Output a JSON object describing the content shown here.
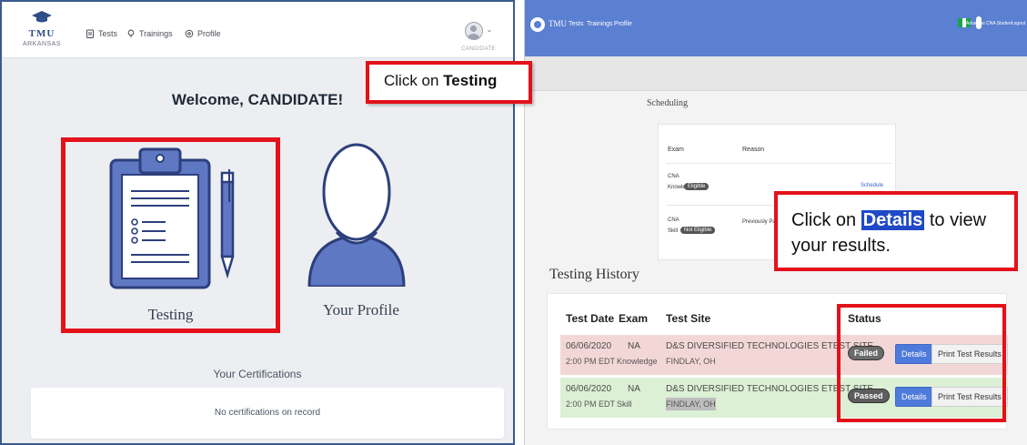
{
  "left_app": {
    "logo": {
      "name": "TMU",
      "subtitle": "ARKANSAS"
    },
    "nav": {
      "tests": "Tests",
      "trainings": "Trainings",
      "profile": "Profile"
    },
    "user_label": "CANDIDATE",
    "welcome": "Welcome, CANDIDATE!",
    "tiles": {
      "testing": "Testing",
      "profile": "Your Profile"
    },
    "certifications": {
      "title": "Your Certifications",
      "empty": "No certifications on record"
    }
  },
  "right_app": {
    "brand": "TMU",
    "nav": {
      "tests": "Tests",
      "trainings": "Trainings",
      "profile": "Profile"
    },
    "user_label": "Arkansas CNA Student",
    "logout": "Logout",
    "scheduling": {
      "title": "Scheduling",
      "headers": {
        "exam": "Exam",
        "reason": "Reason"
      },
      "rows": [
        {
          "exam": "CNA",
          "sub": "Knowledge",
          "chip": "Eligible",
          "reason": "",
          "action": "Schedule"
        },
        {
          "exam": "CNA",
          "sub": "Skill",
          "chip": "Not Eligible",
          "reason": "Previously Passed",
          "action": ""
        }
      ]
    },
    "history": {
      "title": "Testing History",
      "headers": {
        "date": "Test Date",
        "exam": "Exam",
        "site": "Test Site",
        "status": "Status"
      },
      "rows": [
        {
          "date": "06/06/2020",
          "time": "2:00 PM EDT",
          "exam": "NA",
          "exam_type": "Knowledge",
          "site": "D&S DIVERSIFIED TECHNOLOGIES ETEST SITE",
          "city": "FINDLAY, OH",
          "status": "Failed",
          "details": "Details",
          "print": "Print Test Results"
        },
        {
          "date": "06/06/2020",
          "time": "2:00 PM EDT",
          "exam": "NA",
          "exam_type": "Skill",
          "site": "D&S DIVERSIFIED TECHNOLOGIES ETEST SITE",
          "city": "FINDLAY, OH",
          "status": "Passed",
          "details": "Details",
          "print": "Print Test Results"
        }
      ]
    }
  },
  "callouts": {
    "first": {
      "prefix": "Click on ",
      "bold": "Testing"
    },
    "second": {
      "prefix": "Click on ",
      "highlight": "Details",
      "suffix": " to view your results."
    }
  },
  "colors": {
    "annotation_red": "#e3111a",
    "right_header_blue": "#5b7fd1",
    "details_button": "#4d7adb",
    "failed_row": "#f3d7d7",
    "passed_row": "#dbf0d4",
    "testing_icon_blue": "#5f78c4"
  },
  "icons": [
    "graduation-cap-icon",
    "clipboard-icon",
    "lightbulb-icon",
    "gear-icon",
    "user-avatar-icon",
    "chevron-down-icon",
    "clipboard-pen-illustration",
    "person-silhouette-illustration"
  ]
}
